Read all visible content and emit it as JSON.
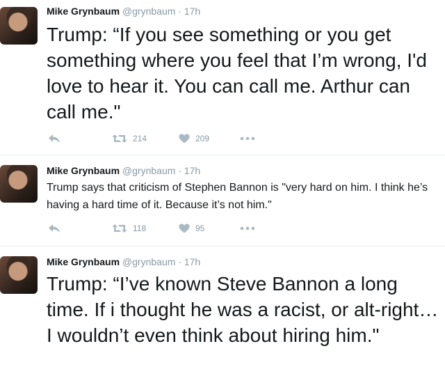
{
  "tweets": [
    {
      "name": "Mike Grynbaum",
      "handle": "@grynbaum",
      "separator": "·",
      "time": "17h",
      "text": "Trump: “If you see something or you get something where you feel that I’m wrong, I'd love to hear it. You can call me. Arthur can call me.\"",
      "retweets": "214",
      "likes": "209"
    },
    {
      "name": "Mike Grynbaum",
      "handle": "@grynbaum",
      "separator": "·",
      "time": "17h",
      "text": "Trump says that criticism of Stephen Bannon is \"very hard on him. I think he’s having a hard time of it. Because it’s not him.\"",
      "retweets": "118",
      "likes": "95"
    },
    {
      "name": "Mike Grynbaum",
      "handle": "@grynbaum",
      "separator": "·",
      "time": "17h",
      "text": "Trump: “I’ve known Steve Bannon a long time. If i thought he was a racist, or alt-right…I wouldn’t even think about hiring him.\""
    }
  ],
  "icons": {
    "reply": "reply-icon",
    "retweet": "retweet-icon",
    "like": "heart-icon",
    "more": "more-icon"
  },
  "colors": {
    "name": "#14171a",
    "meta": "#8899a6",
    "icon": "#aab8c2",
    "divider": "#e6ecf0"
  }
}
